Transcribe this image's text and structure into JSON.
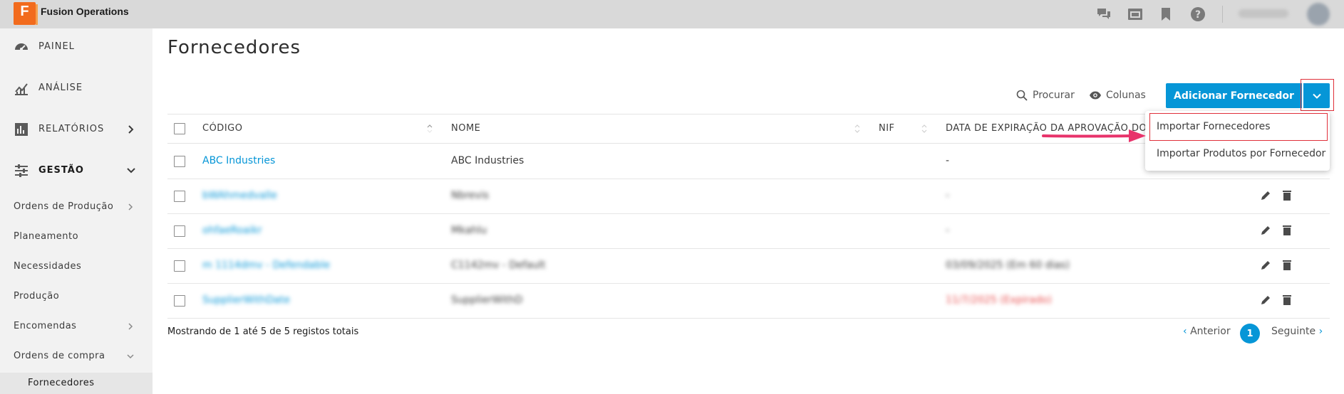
{
  "app": {
    "logo_letter": "F",
    "title": "Fusion Operations"
  },
  "topbar": {
    "icons": [
      "chat-icon",
      "window-icon",
      "bookmark-icon",
      "help-icon"
    ],
    "user_name": "",
    "accent": "#f26b1d"
  },
  "sidebar": {
    "main_items": [
      {
        "label": "PAINEL",
        "icon": "dashboard-gauge-icon"
      },
      {
        "label": "ANÁLISE",
        "icon": "analytics-chart-icon"
      },
      {
        "label": "RELATÓRIOS",
        "icon": "reports-icon"
      },
      {
        "label": "GESTÃO",
        "icon": "management-sliders-icon"
      }
    ],
    "sub_items": [
      {
        "label": "Ordens de Produção"
      },
      {
        "label": "Planeamento"
      },
      {
        "label": "Necessidades"
      },
      {
        "label": "Produção"
      },
      {
        "label": "Encomendas"
      },
      {
        "label": "Ordens de compra"
      },
      {
        "label": "Fornecedores"
      }
    ]
  },
  "page": {
    "title": "Fornecedores",
    "search_label": "Procurar",
    "columns_label": "Colunas",
    "add_button_label": "Adicionar Fornecedor"
  },
  "table": {
    "headers": [
      "CÓDIGO",
      "NOME",
      "NIF",
      "DATA DE EXPIRAÇÃO DA APROVAÇÃO DO FO"
    ],
    "rows": [
      {
        "code": "ABC Industries",
        "name": "ABC Industries",
        "date": "-"
      },
      {
        "code": "bWAhmedvalle",
        "name": "Nbrevis",
        "date": "-"
      },
      {
        "code": "ohfaeRoaikr",
        "name": "Mkahlu",
        "date": "-"
      },
      {
        "code": "m 1114dmv - Defendable",
        "name": "C1142mv - Default",
        "date": "03/09/2025 (Em 60 dias)"
      },
      {
        "code": "SupplierWithDate",
        "name": "SupplierWithD",
        "date": "11/7/2025 (Expirado)"
      }
    ]
  },
  "footer": {
    "info": "Mostrando de 1 até 5 de 5 registos totais",
    "prev": "Anterior",
    "next": "Seguinte",
    "current_page": "1"
  },
  "dropdown": {
    "items": [
      {
        "label": "Importar Fornecedores"
      },
      {
        "label": "Importar Produtos por Fornecedor"
      }
    ]
  },
  "colors": {
    "primary": "#0696d7",
    "highlight_box": "#e0303a",
    "arrow": "#e8336b",
    "expired": "#e84b4b"
  }
}
